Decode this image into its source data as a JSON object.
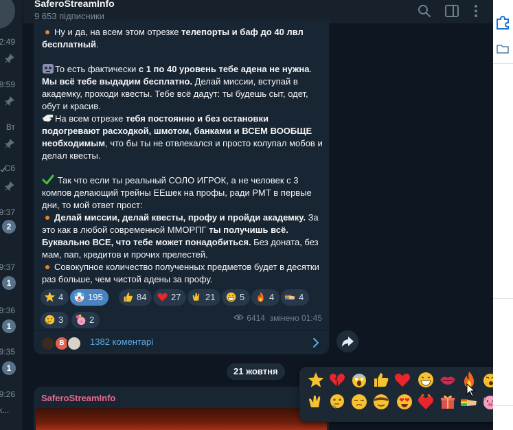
{
  "header": {
    "title": "SaferoStreamInfo",
    "subscribers": "9 653 підписники"
  },
  "chat_list": {
    "items": [
      {
        "time": "2:49",
        "pinned": true
      },
      {
        "time": "8:59",
        "pinned": true
      },
      {
        "time": "Вт",
        "pinned": true
      },
      {
        "time": "Сб",
        "pinned": true,
        "read": true
      },
      {
        "time": "9:37",
        "badge": "2"
      },
      {
        "time": "9:37",
        "badge": "1"
      },
      {
        "time": "9:36",
        "badge": "1"
      },
      {
        "time": "9:35",
        "badge": "1"
      },
      {
        "time": "9:26",
        "preview": "к..."
      }
    ]
  },
  "post": {
    "lines": {
      "l1_a": "Ну и да, на всем этом отрезке ",
      "l1_b": "телепорты и баф до 40 лвл бесплатный",
      "l1_c": ".",
      "l2_a": "То есть фактически ",
      "l2_b": "с 1 по 40 уровень тебе адена не нужна",
      "l2_c": ". ",
      "l2_d": "Мы всё тебе выдадим бесплатно.",
      "l2_e": " Делай миссии, вступай в академку, проходи квесты. Тебе всё дадут: ты будешь сыт, одет, обут и красив.",
      "l3_a": "На всем отрезке ",
      "l3_b": "тебя постоянно и без остановки подогревают расходкой, шмотом, банками и ВСЕМ ВООБЩЕ необходимым",
      "l3_c": ", что бы ты не отвлекался и просто колупал мобов и делал квесты.",
      "l4_a": " Так что если ты реальный СОЛО ИГРОК, а не человек с 3 компов делающий трейны ЕЕшек на профы, ради РМТ в первые дни, то мой ответ прост:",
      "l5_a": "Делай миссии, делай квесты, профу и пройди академку.",
      "l5_b": " За это как в любой современной ММОРПГ ",
      "l5_c": "ты получишь всё. Буквально ВСЕ, что тебе может понадобиться.",
      "l5_d": " Без доната, без мам, пап, кредитов и прочих прелестей.",
      "l6_a": "Совокупное количество полученных предметов будет в десятки раз больше, чем чистой адены за профу."
    },
    "reactions": [
      {
        "emoji": "star",
        "count": "4"
      },
      {
        "emoji": "clown",
        "count": "195",
        "selected": true
      },
      {
        "emoji": "thumbs-up",
        "count": "84"
      },
      {
        "emoji": "heart",
        "count": "27"
      },
      {
        "emoji": "clap",
        "count": "21"
      },
      {
        "emoji": "grin",
        "count": "5"
      },
      {
        "emoji": "fire",
        "count": "4"
      },
      {
        "emoji": "rainbow-hand",
        "count": "4"
      },
      {
        "emoji": "thinking",
        "count": "3"
      },
      {
        "emoji": "pig-flowers",
        "count": "2"
      }
    ],
    "views": "6414",
    "edited": "змінено 01:45",
    "comments": "1382 коментарі",
    "commenter_initial": "В"
  },
  "date_separator": "21 жовтня",
  "next_post": {
    "author": "SaferoStreamInfo"
  },
  "emoji_picker": {
    "row1": [
      "star",
      "broken-heart",
      "screaming-face",
      "thumbs-up",
      "red-heart",
      "grinning-face",
      "lips",
      "fire",
      "yawning-face"
    ],
    "row2": [
      "clapping-hands",
      "thinking-face",
      "unamused-face",
      "star-struck-face",
      "heart-eyes-face",
      "heart-on-fire",
      "gift",
      "rainbow-handshake",
      "pig-face"
    ]
  },
  "colors": {
    "accent": "#5faae9",
    "selected_reaction": "#4a83bf",
    "bubble": "#182533",
    "background": "#0e1621",
    "author_pink": "#e86a8e"
  }
}
